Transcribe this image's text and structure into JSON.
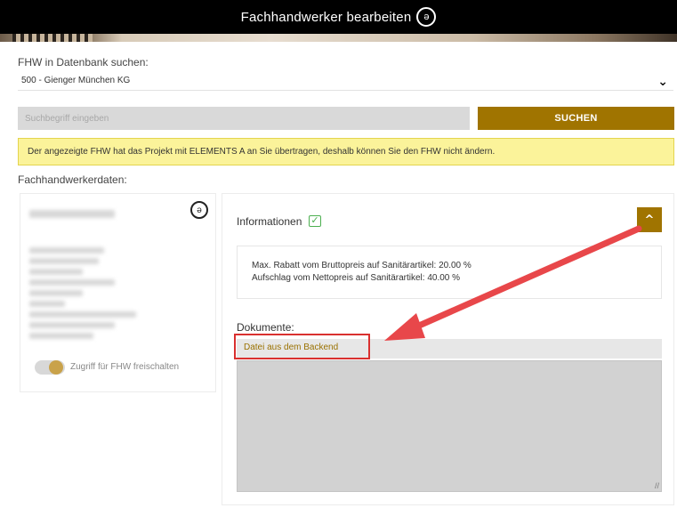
{
  "window": {
    "title": "Fachhandwerker bearbeiten"
  },
  "search": {
    "label": "FHW in Datenbank suchen:",
    "selected_value": "500 - Gienger München KG",
    "placeholder": "Suchbegriff eingeben",
    "button_label": "SUCHEN"
  },
  "notice": {
    "text": "Der angezeigte FHW hat das Projekt mit ELEMENTS A an Sie übertragen, deshalb können Sie den FHW nicht ändern."
  },
  "section": {
    "title": "Fachhandwerkerdaten:"
  },
  "left_card": {
    "toggle_label": "Zugriff für FHW freischalten"
  },
  "info": {
    "title": "Informationen",
    "line1": "Max. Rabatt vom Bruttopreis auf Sanitärartikel: 20.00 %",
    "line2": "Aufschlag vom Nettopreis auf Sanitärartikel: 40.00 %"
  },
  "documents": {
    "title": "Dokumente:",
    "item": "Datei aus dem Backend"
  },
  "icons": {
    "logo": "elements-logo-icon",
    "check": "check-icon",
    "collapse": "chevron-up-icon",
    "dropdown": "chevron-down-icon"
  },
  "colors": {
    "accent": "#a07400",
    "notice_bg": "#fbf39a",
    "highlight": "#d9302f",
    "arrow": "#e8474a"
  }
}
